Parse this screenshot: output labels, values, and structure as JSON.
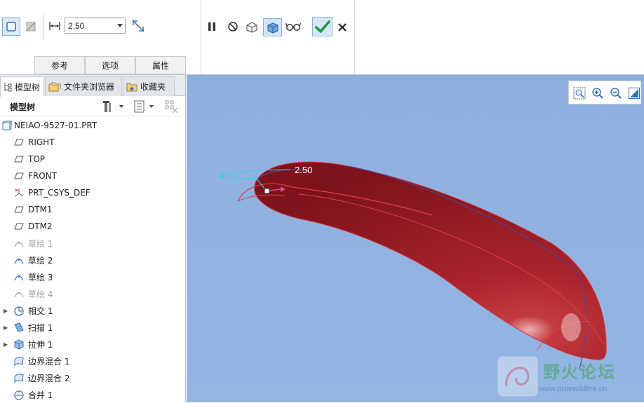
{
  "dashboard": {
    "thickness_value": "2.50",
    "tabs": [
      "参考",
      "选项",
      "属性"
    ]
  },
  "navigator": {
    "tabs": [
      "模型树",
      "文件夹浏览器",
      "收藏夹"
    ],
    "tree_title": "模型树",
    "items": [
      {
        "label": "NEIAO-9527-01.PRT",
        "icon": "part-icon",
        "expandable": false,
        "suppressed": false
      },
      {
        "label": "RIGHT",
        "icon": "datum-plane-icon",
        "expandable": false,
        "suppressed": false
      },
      {
        "label": "TOP",
        "icon": "datum-plane-icon",
        "expandable": false,
        "suppressed": false
      },
      {
        "label": "FRONT",
        "icon": "datum-plane-icon",
        "expandable": false,
        "suppressed": false
      },
      {
        "label": "PRT_CSYS_DEF",
        "icon": "csys-icon",
        "expandable": false,
        "suppressed": false
      },
      {
        "label": "DTM1",
        "icon": "datum-plane-icon",
        "expandable": false,
        "suppressed": false
      },
      {
        "label": "DTM2",
        "icon": "datum-plane-icon",
        "expandable": false,
        "suppressed": false
      },
      {
        "label": "草绘 1",
        "icon": "sketch-icon",
        "expandable": false,
        "suppressed": true
      },
      {
        "label": "草绘 2",
        "icon": "sketch-icon",
        "expandable": false,
        "suppressed": false
      },
      {
        "label": "草绘 3",
        "icon": "sketch-icon",
        "expandable": false,
        "suppressed": false
      },
      {
        "label": "草绘 4",
        "icon": "sketch-icon",
        "expandable": false,
        "suppressed": true
      },
      {
        "label": "相交 1",
        "icon": "intersect-icon",
        "expandable": true,
        "suppressed": false
      },
      {
        "label": "扫描 1",
        "icon": "sweep-icon",
        "expandable": true,
        "suppressed": false
      },
      {
        "label": "拉伸 1",
        "icon": "extrude-icon",
        "expandable": true,
        "suppressed": false
      },
      {
        "label": "边界混合 1",
        "icon": "boundary-blend-icon",
        "expandable": false,
        "suppressed": false
      },
      {
        "label": "边界混合 2",
        "icon": "boundary-blend-icon",
        "expandable": false,
        "suppressed": false
      },
      {
        "label": "合并 1",
        "icon": "merge-icon",
        "expandable": false,
        "suppressed": false
      }
    ]
  },
  "graphics": {
    "dimension_label": "2.50",
    "model_color": "#a3222a",
    "background_color": "#8fb1e0",
    "watermark_title": "野火论坛",
    "watermark_url": "www.proewildfire.cn"
  }
}
